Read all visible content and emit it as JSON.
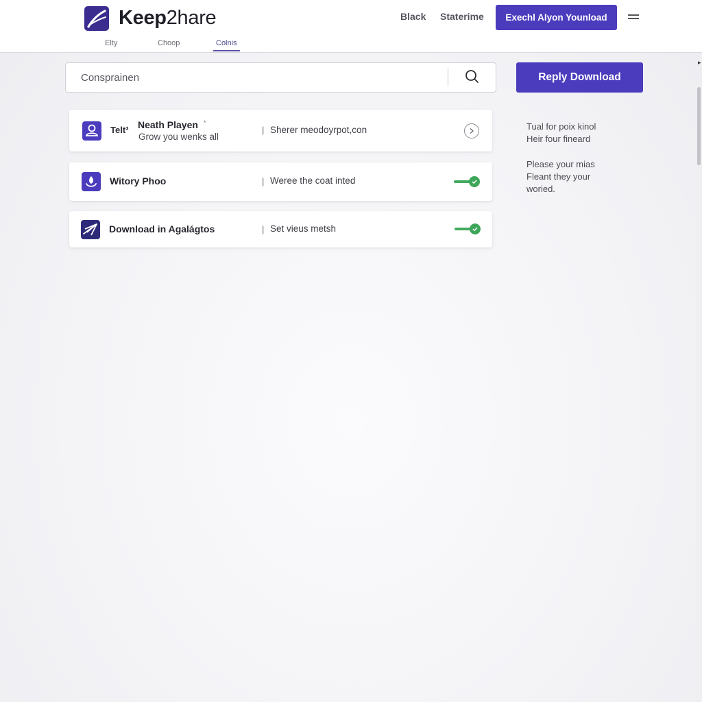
{
  "header": {
    "brand_bold": "Keep",
    "brand_rest": "2hare",
    "subtabs": [
      {
        "label": "Elty",
        "active": false
      },
      {
        "label": "Choop",
        "active": false
      },
      {
        "label": "Colnis",
        "active": true
      }
    ],
    "nav_links": [
      "Black",
      "Staterime"
    ],
    "cta_label": "Exechl Alyon Younload",
    "menu_icon": "hamburger-icon"
  },
  "search": {
    "placeholder": "Consprainen",
    "value": "",
    "icon": "search-icon"
  },
  "sidebar": {
    "button_label": "Reply Download",
    "paragraphs": [
      [
        "Tual for poix kinol",
        "Heir four fineard"
      ],
      [
        "Please your mias",
        "Fleant they your",
        "woried."
      ]
    ]
  },
  "cards": [
    {
      "icon": "user-icon",
      "tag": "Telt³",
      "title": "Neath Playen",
      "marker": "*",
      "subtitle": "Grow you wenks all",
      "separator": "|",
      "description": "Sherer meodoyrpot,con",
      "action": "chevron-right"
    },
    {
      "icon": "download-icon",
      "title": "Witory Phoo",
      "separator": "|",
      "description": "Weree the coat inted",
      "toggle_on": true
    },
    {
      "icon": "paper-plane-icon",
      "title": "Download in Agalágtos",
      "separator": "|",
      "description": "Set vieus metsh",
      "toggle_on": true
    }
  ],
  "colors": {
    "accent": "#4b3bbd",
    "logo": "#3a2d8f",
    "toggle_on": "#3da658"
  }
}
